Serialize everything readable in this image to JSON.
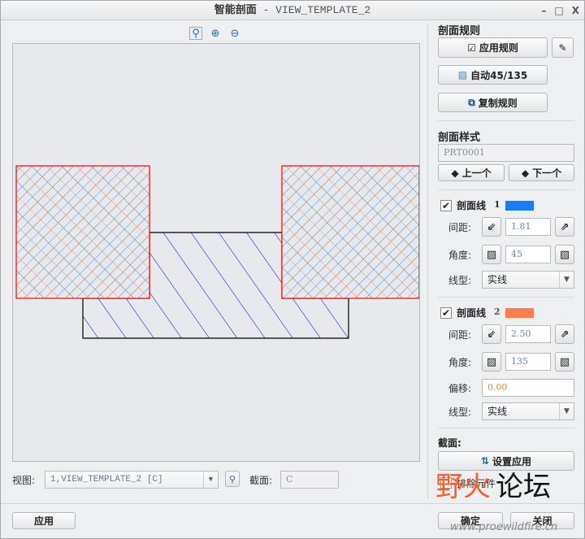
{
  "window": {
    "title": "智能剖面",
    "title_suffix": " - VIEW_TEMPLATE_2",
    "minimize": "–",
    "maximize": "□",
    "close": "X"
  },
  "zoom_tools": [
    "zoom-fit",
    "zoom-in",
    "zoom-out"
  ],
  "rules": {
    "heading": "剖面规则",
    "apply_rules": "应用规则",
    "auto": "自动45/135",
    "copy_rules": "复制规则"
  },
  "style": {
    "heading": "剖面样式",
    "part": "PRT0001",
    "prev": "上一个",
    "next": "下一个"
  },
  "hatch1": {
    "label": "剖面线",
    "index": "1",
    "color": "#1a7ef0",
    "checked": true,
    "spacing_label": "间距:",
    "spacing": "1.81",
    "angle_label": "角度:",
    "angle": "45",
    "linetype_label": "线型:",
    "linetype": "实线"
  },
  "hatch2": {
    "label": "剖面线",
    "index": "2",
    "color": "#ff7d4d",
    "checked": true,
    "spacing_label": "间距:",
    "spacing": "2.50",
    "angle_label": "角度:",
    "angle": "135",
    "offset_label": "偏移:",
    "offset": "0.00",
    "linetype_label": "线型:",
    "linetype": "实线"
  },
  "section": {
    "heading": "截面:",
    "set_apply": "设置应用",
    "exclude": "排除元件",
    "exclude_checked": false
  },
  "view": {
    "label": "视图:",
    "value": "1,VIEW_TEMPLATE_2 [C]",
    "section_label": "截面:",
    "section_value": "C"
  },
  "footer": {
    "apply": "应用",
    "ok": "确定",
    "close": "关闭"
  },
  "watermark": {
    "text_a": "野火",
    "text_b": "论坛",
    "url": "www.proewildfire.cn"
  }
}
